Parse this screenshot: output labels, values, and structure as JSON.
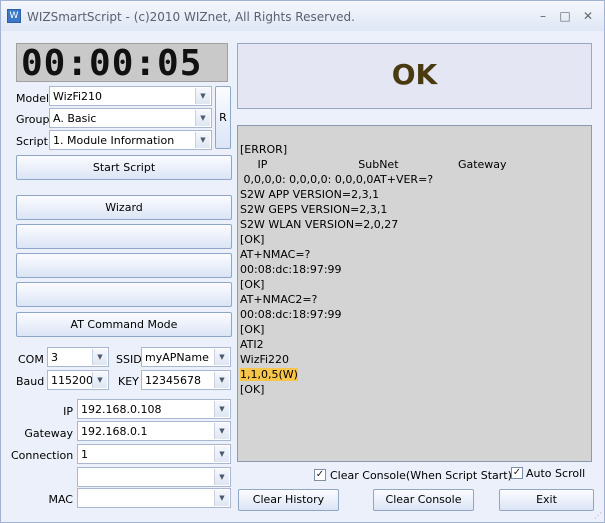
{
  "window": {
    "title": "WIZSmartScript - (c)2010 WIZnet, All Rights Reserved.",
    "icon": "W",
    "controls": {
      "minimize": "–",
      "maximize": "□",
      "close": "✕"
    }
  },
  "timer": {
    "display": "00:00:05"
  },
  "left": {
    "model": {
      "label": "Model",
      "value": "WizFi210"
    },
    "group": {
      "label": "Group",
      "value": "A. Basic"
    },
    "script": {
      "label": "Script",
      "value": "1. Module Information"
    },
    "refresh_label": "R",
    "start_script_label": "Start Script",
    "wizard_label": "Wizard",
    "blank_buttons": [
      "",
      "",
      ""
    ],
    "at_command_label": "AT Command Mode",
    "com": {
      "label": "COM",
      "value": "3"
    },
    "baud": {
      "label": "Baud",
      "value": "115200"
    },
    "ssid": {
      "label": "SSID",
      "value": "myAPName"
    },
    "key": {
      "label": "KEY",
      "value": "12345678"
    },
    "ip": {
      "label": "IP",
      "value": "192.168.0.108"
    },
    "gateway": {
      "label": "Gateway",
      "value": "192.168.0.1"
    },
    "connection": {
      "label": "Connection",
      "value": "1"
    },
    "extra": {
      "value": ""
    },
    "mac": {
      "label": "MAC",
      "value": ""
    }
  },
  "status": {
    "text": "OK"
  },
  "console": {
    "lines": [
      "[ERROR]",
      "     IP                          SubNet                 Gateway",
      " 0,0,0,0: 0,0,0,0: 0,0,0,0AT+VER=?",
      "S2W APP VERSION=2,3,1",
      "S2W GEPS VERSION=2,3,1",
      "S2W WLAN VERSION=2,0,27",
      "[OK]",
      "AT+NMAC=?",
      "00:08:dc:18:97:99",
      "[OK]",
      "AT+NMAC2=?",
      "00:08:dc:18:97:99",
      "[OK]",
      "ATI2",
      "WizFi220",
      "1,1,0,5(W)",
      "[OK]"
    ],
    "highlight_line": 15,
    "highlight_color": "#f7c54a"
  },
  "options": {
    "clear_console_on_start": {
      "label": "Clear Console(When Script Start)",
      "checked": true,
      "mark": "✓"
    },
    "auto_scroll": {
      "label": "Auto Scroll",
      "checked": true,
      "mark": "✓"
    }
  },
  "bottom": {
    "clear_history_label": "Clear History",
    "clear_console_label": "Clear Console",
    "exit_label": "Exit"
  }
}
